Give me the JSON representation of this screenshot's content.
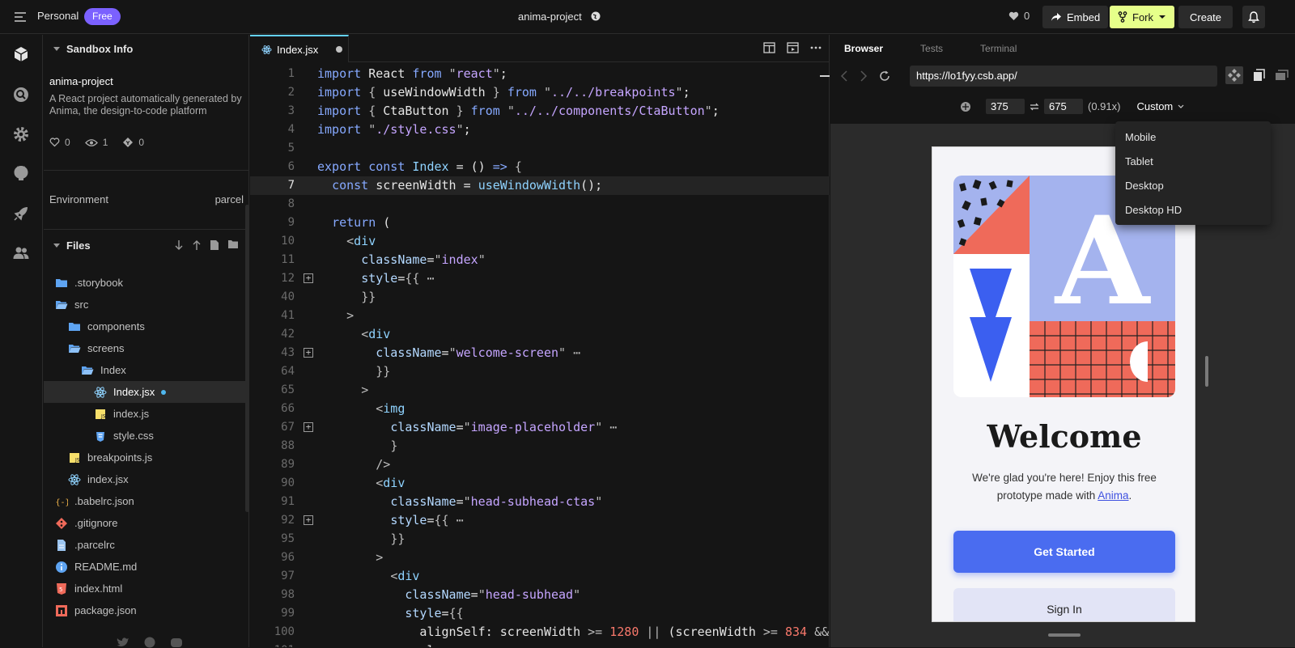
{
  "topbar": {
    "workspace": "Personal",
    "plan_badge": "Free",
    "project_title": "anima-project",
    "likes": "0",
    "embed_label": "Embed",
    "fork_label": "Fork",
    "create_label": "Create"
  },
  "sidebar": {
    "section_title": "Sandbox Info",
    "project_name": "anima-project",
    "description": "A React project automatically generated by Anima, the design-to-code platform",
    "stats": {
      "likes": "0",
      "views": "1",
      "forks": "0"
    },
    "environment_label": "Environment",
    "environment_value": "parcel",
    "files_title": "Files",
    "files": [
      {
        "name": ".storybook",
        "type": "folder",
        "depth": 0
      },
      {
        "name": "src",
        "type": "folder-open",
        "depth": 0
      },
      {
        "name": "components",
        "type": "folder",
        "depth": 1
      },
      {
        "name": "screens",
        "type": "folder-open",
        "depth": 1
      },
      {
        "name": "Index",
        "type": "folder-open",
        "depth": 2
      },
      {
        "name": "Index.jsx",
        "type": "react",
        "depth": 3,
        "active": true,
        "modified": true
      },
      {
        "name": "index.js",
        "type": "js",
        "depth": 3
      },
      {
        "name": "style.css",
        "type": "css",
        "depth": 3
      },
      {
        "name": "breakpoints.js",
        "type": "js",
        "depth": 1
      },
      {
        "name": "index.jsx",
        "type": "react",
        "depth": 1
      },
      {
        "name": ".babelrc.json",
        "type": "json",
        "depth": 0
      },
      {
        "name": ".gitignore",
        "type": "git",
        "depth": 0
      },
      {
        "name": ".parcelrc",
        "type": "file",
        "depth": 0
      },
      {
        "name": "README.md",
        "type": "info",
        "depth": 0
      },
      {
        "name": "index.html",
        "type": "html",
        "depth": 0
      },
      {
        "name": "package.json",
        "type": "npm",
        "depth": 0
      }
    ]
  },
  "editor": {
    "tab_label": "Index.jsx",
    "lines": [
      {
        "n": "1",
        "html": "<span class=\"kw\">import</span> React <span class=\"kw\">from</span> <span class=\"pn\">\"</span><span class=\"st\">react</span><span class=\"pn\">\"</span>;"
      },
      {
        "n": "2",
        "html": "<span class=\"kw\">import</span> <span class=\"pn\">{</span> useWindowWidth <span class=\"pn\">}</span> <span class=\"kw\">from</span> <span class=\"pn\">\"</span><span class=\"st\">../../breakpoints</span><span class=\"pn\">\"</span>;"
      },
      {
        "n": "3",
        "html": "<span class=\"kw\">import</span> <span class=\"pn\">{</span> CtaButton <span class=\"pn\">}</span> <span class=\"kw\">from</span> <span class=\"pn\">\"</span><span class=\"st\">../../components/CtaButton</span><span class=\"pn\">\"</span>;"
      },
      {
        "n": "4",
        "html": "<span class=\"kw\">import</span> <span class=\"pn\">\"</span><span class=\"st\">./style.css</span><span class=\"pn\">\"</span>;"
      },
      {
        "n": "5",
        "html": ""
      },
      {
        "n": "6",
        "html": "<span class=\"kw\">export const</span> <span class=\"jx\">Index</span> = () <span class=\"kw\">=&gt;</span> <span class=\"pn\">{</span>"
      },
      {
        "n": "7",
        "html": "  <span class=\"kw\">const</span> screenWidth = <span class=\"jx\">useWindowWidth</span>();",
        "hl": true
      },
      {
        "n": "8",
        "html": ""
      },
      {
        "n": "9",
        "html": "  <span class=\"kw\">return</span> ("
      },
      {
        "n": "10",
        "html": "    <span class=\"pn\">&lt;</span><span class=\"jx\">div</span>"
      },
      {
        "n": "11",
        "html": "      <span class=\"at\">className</span>=<span class=\"pn\">\"</span><span class=\"st\">index</span><span class=\"pn\">\"</span>"
      },
      {
        "n": "12",
        "html": "      <span class=\"at\">style</span>=<span class=\"pn\">{{</span> <span class=\"pn\">⋯</span>",
        "fold": true
      },
      {
        "n": "40",
        "html": "      <span class=\"pn\">}}</span>"
      },
      {
        "n": "41",
        "html": "    <span class=\"pn\">&gt;</span>"
      },
      {
        "n": "42",
        "html": "      <span class=\"pn\">&lt;</span><span class=\"jx\">div</span>"
      },
      {
        "n": "43",
        "html": "        <span class=\"at\">className</span>=<span class=\"pn\">\"</span><span class=\"st\">welcome-screen</span><span class=\"pn\">\"</span> <span class=\"pn\">⋯</span>",
        "fold": true
      },
      {
        "n": "64",
        "html": "        <span class=\"pn\">}}</span>"
      },
      {
        "n": "65",
        "html": "      <span class=\"pn\">&gt;</span>"
      },
      {
        "n": "66",
        "html": "        <span class=\"pn\">&lt;</span><span class=\"jx\">img</span>"
      },
      {
        "n": "67",
        "html": "          <span class=\"at\">className</span>=<span class=\"pn\">\"</span><span class=\"st\">image-placeholder</span><span class=\"pn\">\"</span> <span class=\"pn\">⋯</span>",
        "fold": true
      },
      {
        "n": "88",
        "html": "          <span class=\"pn\">}</span>"
      },
      {
        "n": "89",
        "html": "        <span class=\"pn\">/&gt;</span>"
      },
      {
        "n": "90",
        "html": "        <span class=\"pn\">&lt;</span><span class=\"jx\">div</span>"
      },
      {
        "n": "91",
        "html": "          <span class=\"at\">className</span>=<span class=\"pn\">\"</span><span class=\"st\">head-subhead-ctas</span><span class=\"pn\">\"</span>"
      },
      {
        "n": "92",
        "html": "          <span class=\"at\">style</span>=<span class=\"pn\">{{</span> <span class=\"pn\">⋯</span>",
        "fold": true
      },
      {
        "n": "95",
        "html": "          <span class=\"pn\">}}</span>"
      },
      {
        "n": "96",
        "html": "        <span class=\"pn\">&gt;</span>"
      },
      {
        "n": "97",
        "html": "          <span class=\"pn\">&lt;</span><span class=\"jx\">div</span>"
      },
      {
        "n": "98",
        "html": "            <span class=\"at\">className</span>=<span class=\"pn\">\"</span><span class=\"st\">head-subhead</span><span class=\"pn\">\"</span>"
      },
      {
        "n": "99",
        "html": "            <span class=\"at\">style</span>=<span class=\"pn\">{{</span>"
      },
      {
        "n": "100",
        "html": "              alignSelf: screenWidth <span class=\"pn\">&gt;=</span> <span class=\"nu\">1280</span> <span class=\"pn\">||</span> (screenWidth <span class=\"pn\">&gt;=</span> <span class=\"nu\">834</span> <span class=\"pn\">&amp;&amp;</span>"
      },
      {
        "n": "101",
        "html": "              al"
      }
    ]
  },
  "preview": {
    "tabs": [
      "Browser",
      "Tests",
      "Terminal"
    ],
    "url": "https://lo1fyy.csb.app/",
    "width": "375",
    "height": "675",
    "zoom": "(0.91x)",
    "preset": "Custom",
    "preset_options": [
      "Mobile",
      "Tablet",
      "Desktop",
      "Desktop HD"
    ],
    "app": {
      "heading": "Welcome",
      "subtext_before": "We're glad you're here! Enjoy this free prototype made with ",
      "subtext_link": "Anima",
      "subtext_after": ".",
      "primary_cta": "Get Started",
      "secondary_cta": "Sign In",
      "art_letter": "A",
      "colors": {
        "accent": "#4a6cf0",
        "coral": "#ef6a5a",
        "periwinkle": "#a4b3ee"
      }
    }
  },
  "colors": {
    "fork": "#e6ff8a",
    "badge": "#7b61ff",
    "active_tab": "#64d2ff"
  }
}
